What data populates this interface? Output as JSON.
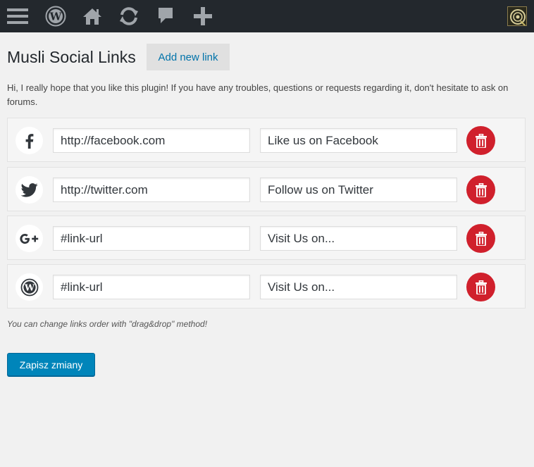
{
  "adminbar": {
    "icons": [
      "menu-icon",
      "wordpress-icon",
      "home-icon",
      "updates-icon",
      "comments-icon",
      "new-content-icon"
    ],
    "avatar": "user-avatar"
  },
  "page": {
    "title": "Musli Social Links",
    "add_new_label": "Add new link",
    "intro": "Hi, I really hope that you like this plugin! If you have any troubles, questions or requests regarding it, don't hesitate to ask on forums.",
    "hint": "You can change links order with \"drag&drop\" method!",
    "save_label": "Zapisz zmiany"
  },
  "links": [
    {
      "icon": "facebook-icon",
      "url": "http://facebook.com",
      "label": "Like us on Facebook"
    },
    {
      "icon": "twitter-icon",
      "url": "http://twitter.com",
      "label": "Follow us on Twitter"
    },
    {
      "icon": "google-plus-icon",
      "url": "#link-url",
      "label": "Visit Us on..."
    },
    {
      "icon": "wordpress-icon",
      "url": "#link-url",
      "label": "Visit Us on..."
    }
  ],
  "colors": {
    "adminbar": "#23282d",
    "accent": "#0085ba",
    "delete": "#d0202c",
    "link": "#0073aa"
  }
}
